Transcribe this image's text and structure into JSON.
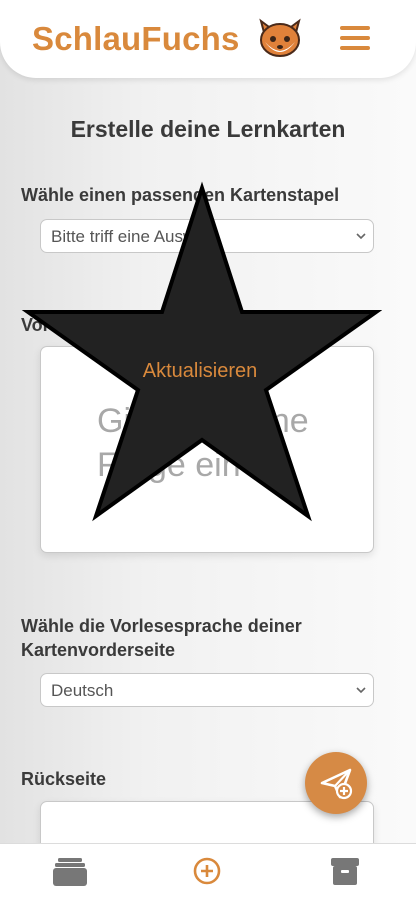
{
  "app": {
    "brand": "SchlauFuchs",
    "logo_icon": "fox-icon",
    "menu_icon": "hamburger-menu-icon",
    "accent_color": "#d9893c"
  },
  "main": {
    "title": "Erstelle deine Lernkarten",
    "deck": {
      "label": "Wähle einen passenden Kartenstapel",
      "selected": "Bitte triff eine Auswahl"
    },
    "front": {
      "label": "Vorderseite",
      "placeholder": "Gib hier deine Frage ein"
    },
    "overlay": {
      "shape": "star",
      "button_label": "Aktualisieren"
    },
    "voice": {
      "label": "Wähle die Vorlesesprache deiner Kartenvorderseite",
      "selected": "Deutsch"
    },
    "back": {
      "label": "Rückseite"
    },
    "fab_icon": "send-plus-icon"
  },
  "bottom_nav": {
    "items": [
      {
        "icon": "card-stack-icon"
      },
      {
        "icon": "add-circle-icon"
      },
      {
        "icon": "archive-box-icon"
      }
    ]
  }
}
